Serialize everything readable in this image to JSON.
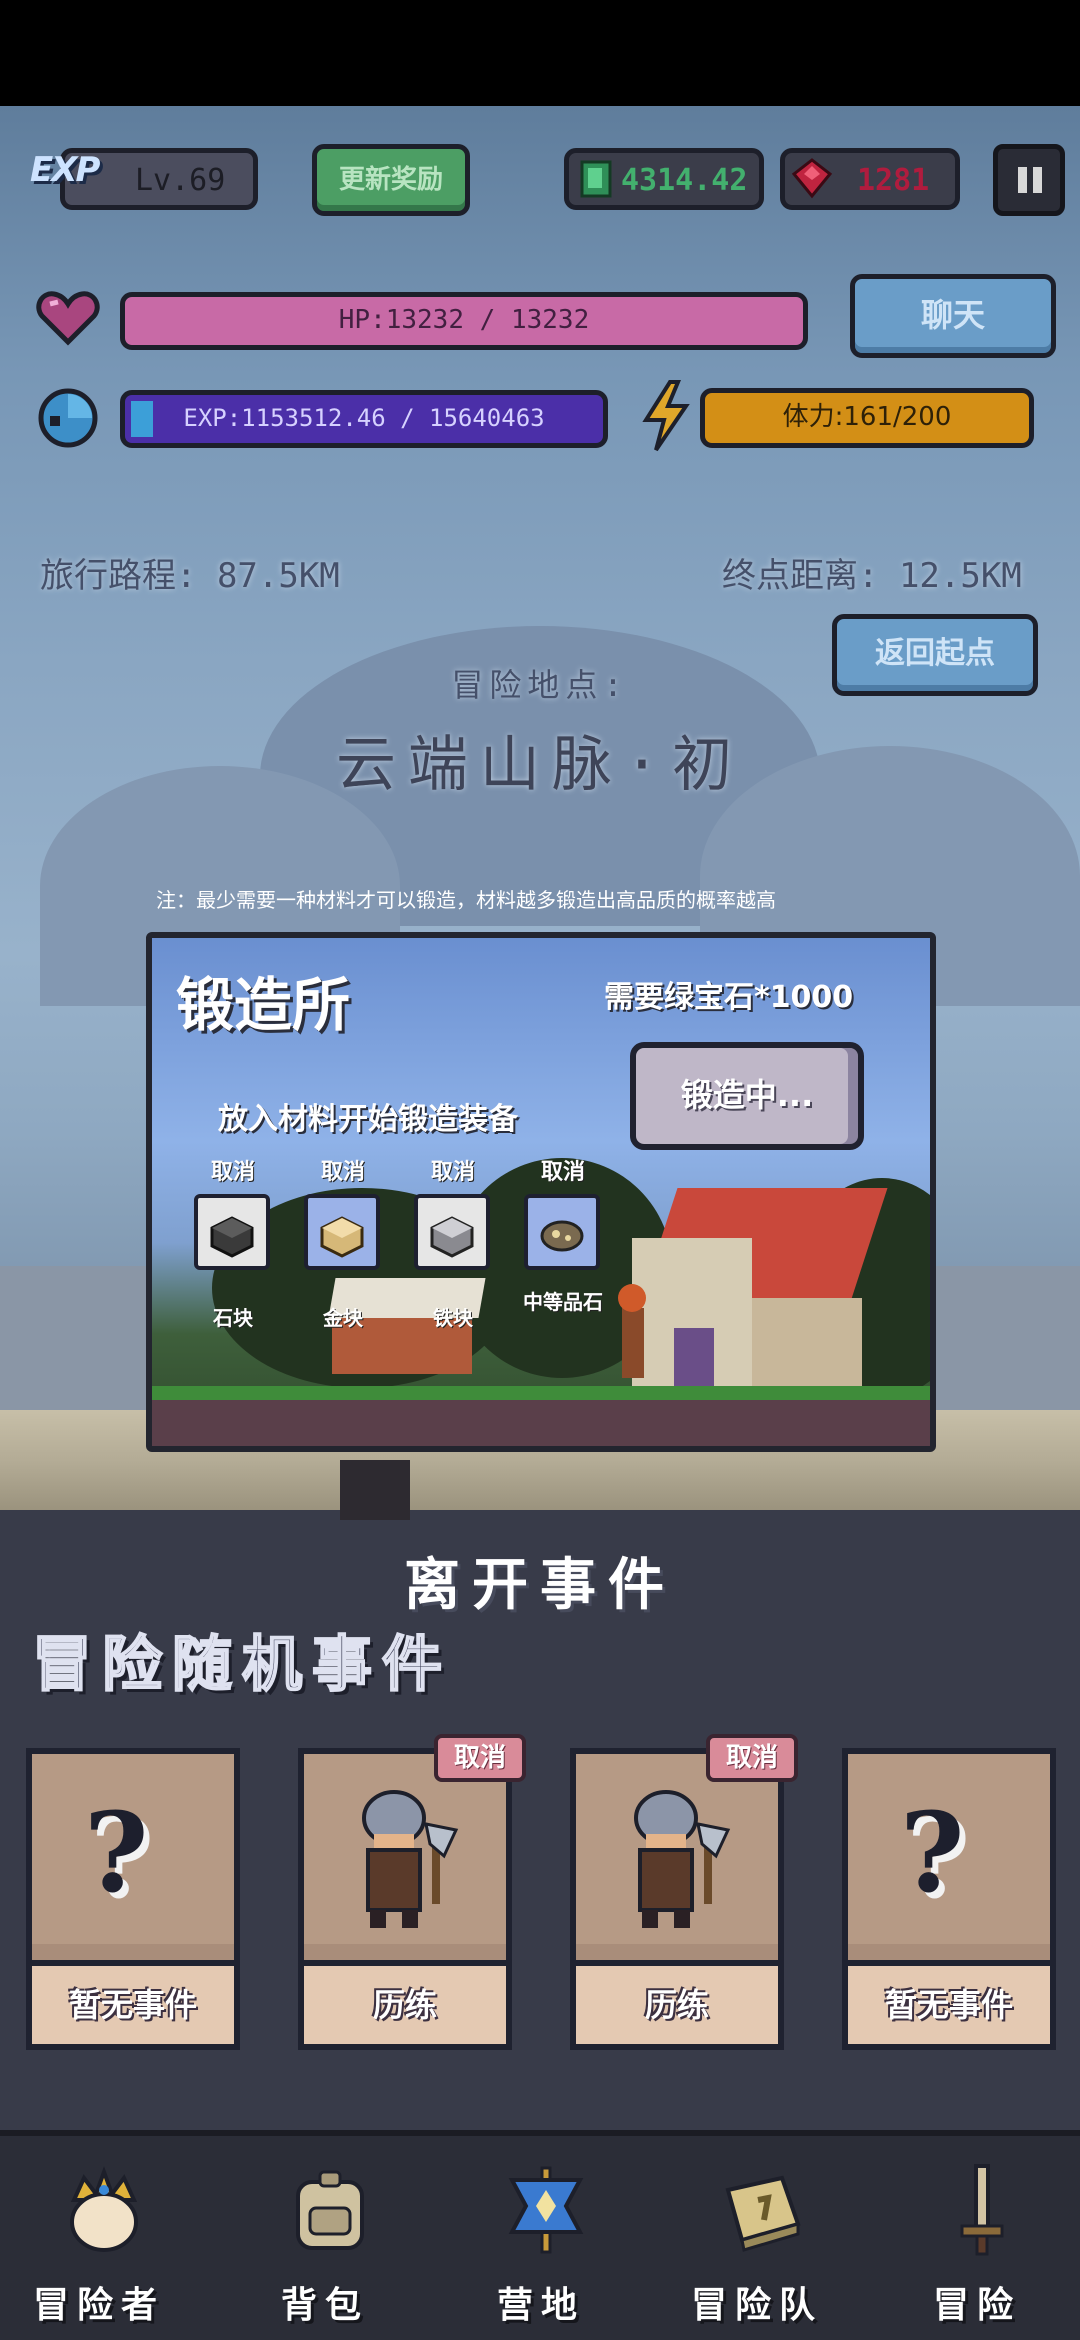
{
  "hud": {
    "exp_badge": "EXP",
    "level": "Lv.69",
    "update_reward": "更新奖励",
    "emeralds": "4314.42",
    "rubies": "1281",
    "hp_text": "HP:13232 / 13232",
    "exp_text": "EXP:1153512.46 / 15640463",
    "stamina_text": "体力:161/200",
    "chat": "聊天"
  },
  "journey": {
    "travel": "旅行路程: 87.5KM",
    "distance": "终点距离: 12.5KM",
    "return": "返回起点",
    "location_label": "冒险地点:",
    "location_name": "云端山脉·初"
  },
  "forge": {
    "note": "注：最少需要一种材料才可以锻造，材料越多锻造出高品质的概率越高",
    "title": "锻造所",
    "cost": "需要绿宝石*1000",
    "button": "锻造中...",
    "subtitle": "放入材料开始锻造装备",
    "slots": [
      {
        "cancel": "取消",
        "name": "石块"
      },
      {
        "cancel": "取消",
        "name": "金块"
      },
      {
        "cancel": "取消",
        "name": "铁块"
      },
      {
        "cancel": "取消",
        "name": "中等品石"
      }
    ]
  },
  "events": {
    "leave": "离开事件",
    "title": "冒险随机事件",
    "cards": [
      {
        "label": "暂无事件",
        "cancel": ""
      },
      {
        "label": "历练",
        "cancel": "取消"
      },
      {
        "label": "历练",
        "cancel": "取消"
      },
      {
        "label": "暂无事件",
        "cancel": ""
      }
    ]
  },
  "nav": {
    "items": [
      {
        "label": "冒险者",
        "icon": "crown-helmet-icon"
      },
      {
        "label": "背包",
        "icon": "backpack-icon"
      },
      {
        "label": "营地",
        "icon": "camp-banner-icon"
      },
      {
        "label": "冒险队",
        "icon": "guild-book-icon"
      },
      {
        "label": "冒险",
        "icon": "sword-icon"
      }
    ]
  },
  "colors": {
    "hp": "#c86aa6",
    "exp": "#4b2fa8",
    "stamina": "#d38f16",
    "emerald": "#43b06e",
    "ruby": "#b01c3e",
    "button_blue": "#6a9dc8"
  }
}
